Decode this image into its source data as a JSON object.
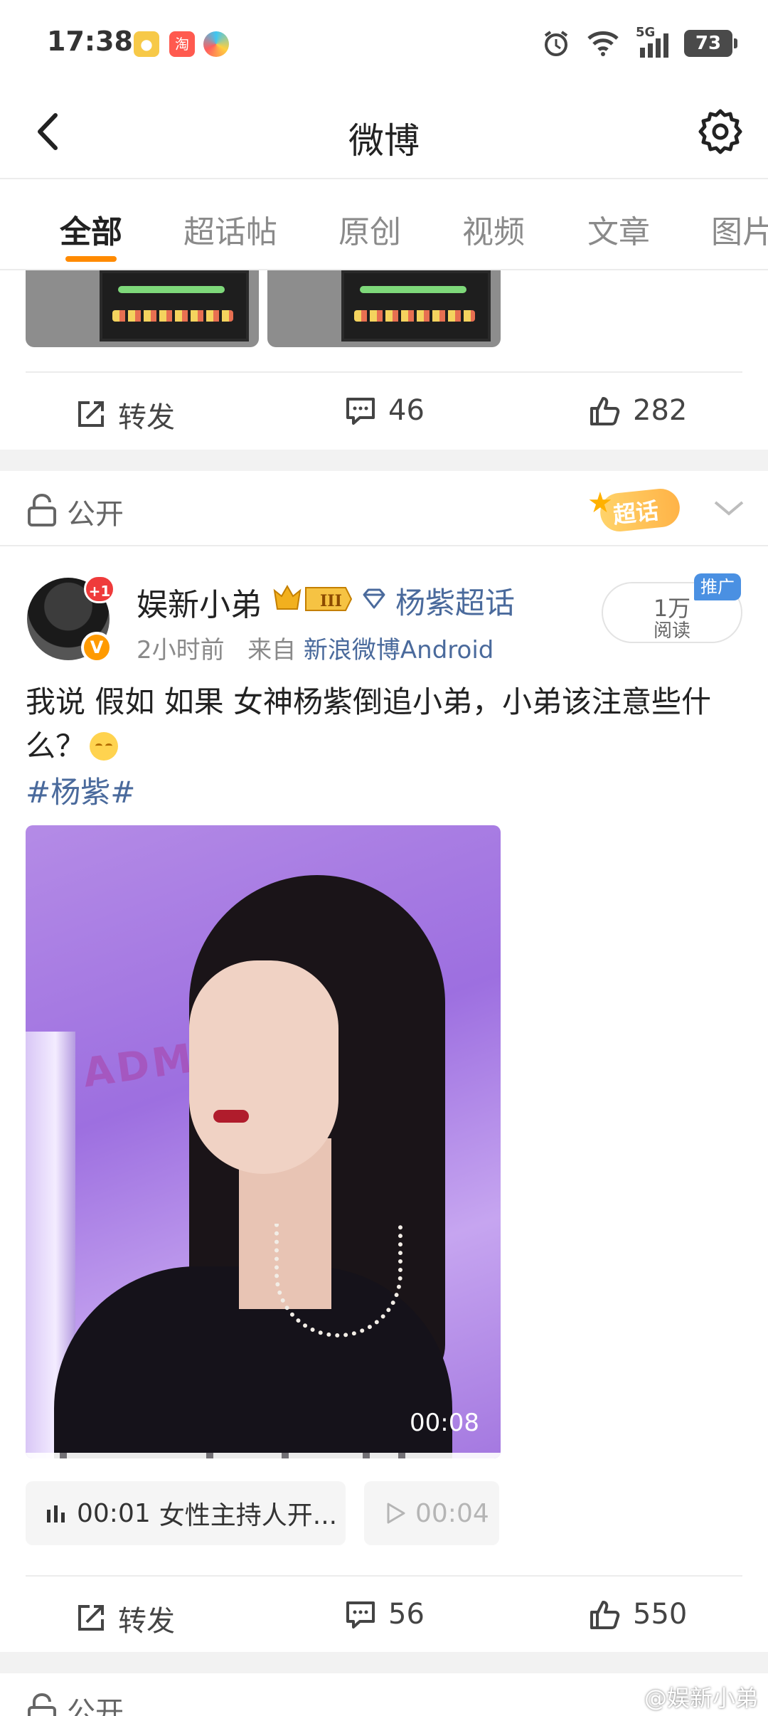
{
  "status_bar": {
    "time": "17:38",
    "battery": "73",
    "network": "5G",
    "icons": [
      "weibo-app-icon",
      "taobao-app-icon",
      "color-app-icon",
      "alarm-icon",
      "wifi-icon",
      "signal-icon",
      "battery-icon"
    ]
  },
  "nav": {
    "title": "微博",
    "back_icon": "back-icon",
    "settings_icon": "gear-icon"
  },
  "tabs": [
    {
      "label": "全部",
      "active": true
    },
    {
      "label": "超话帖",
      "active": false
    },
    {
      "label": "原创",
      "active": false
    },
    {
      "label": "视频",
      "active": false
    },
    {
      "label": "文章",
      "active": false
    },
    {
      "label": "图片",
      "active": false
    }
  ],
  "accent_color": "#ff8a00",
  "previous_post": {
    "actions": {
      "repost": "转发",
      "comments": "46",
      "likes": "282"
    }
  },
  "post": {
    "visibility": "公开",
    "supertopic_badge": "超话",
    "author": {
      "name": "娱新小弟",
      "avatar_notification": "+1",
      "verified_mark": "V",
      "supertopic": "杨紫超话"
    },
    "time": "2小时前",
    "source_prefix": "来自",
    "source": "新浪微博Android",
    "reads": {
      "count": "1万",
      "label": "阅读"
    },
    "promo_tag": "推广",
    "text": "我说 假如 如果 女神杨紫倒追小弟，小弟该注意些什么？",
    "hashtag": "#杨紫#",
    "video": {
      "duration": "00:08",
      "bg_text": "ADM M"
    },
    "chapters": [
      {
        "time": "00:01",
        "label": "女性主持人开..."
      },
      {
        "time": "00:04",
        "label": ""
      }
    ],
    "actions": {
      "repost": "转发",
      "comments": "56",
      "likes": "550"
    }
  },
  "next_post": {
    "visibility": "公开"
  },
  "watermark": "@娱新小弟"
}
